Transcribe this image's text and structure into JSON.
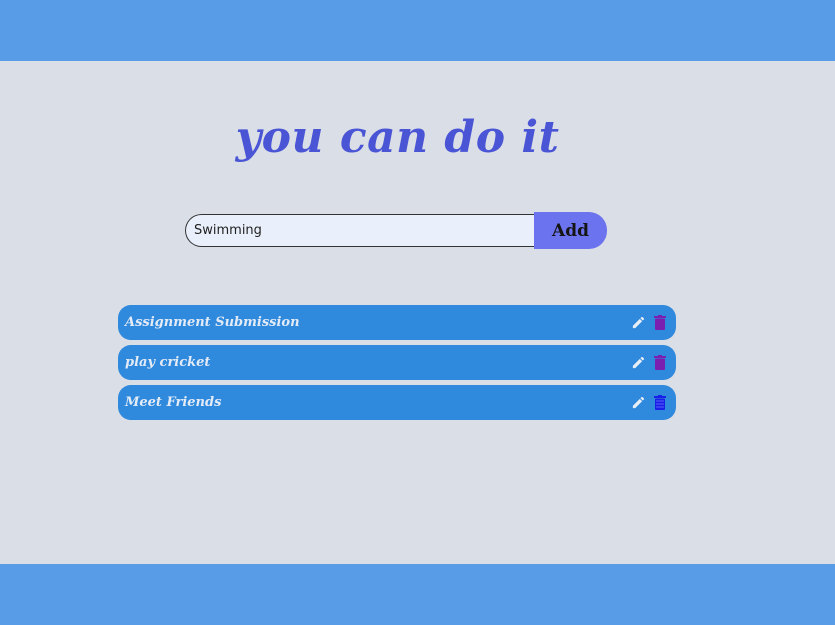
{
  "header": {
    "title": "you can do it"
  },
  "form": {
    "input_value": "Swimming",
    "add_label": "Add"
  },
  "todos": [
    {
      "text": "Assignment Submission",
      "delete_icon_color": "#7a1fb0"
    },
    {
      "text": "play cricket",
      "delete_icon_color": "#7a1fb0"
    },
    {
      "text": "Meet Friends",
      "delete_icon_color": "#1a1fe8"
    }
  ],
  "icons": {
    "edit": "pencil-icon",
    "delete": "trash-icon"
  },
  "colors": {
    "band": "#589be6",
    "background": "#dadee6",
    "title": "#4a55d6",
    "add_button": "#6c73ee",
    "item_background": "#2f89dd",
    "edit_icon": "#e8eef8"
  }
}
